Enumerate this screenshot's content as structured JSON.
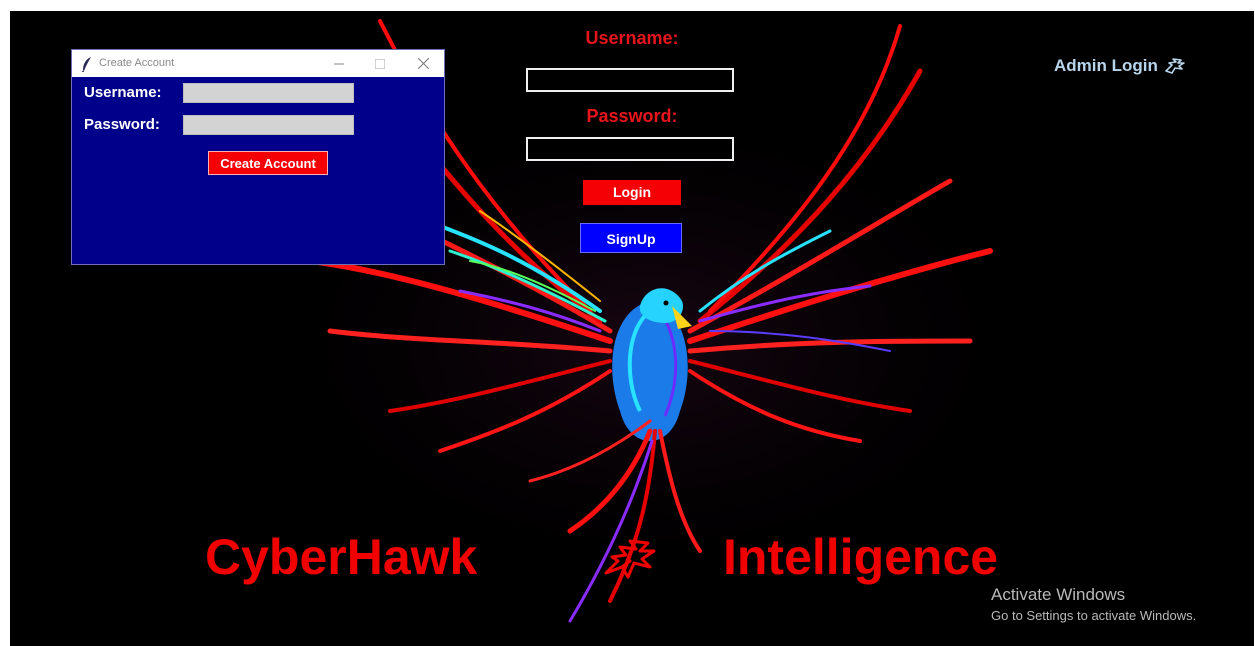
{
  "login_panel": {
    "username_label": "Username:",
    "password_label": "Password:",
    "username_value": "",
    "password_value": "",
    "login_button": "Login",
    "signup_button": "SignUp"
  },
  "admin": {
    "label": "Admin Login",
    "icon": "hawk-icon"
  },
  "brand": {
    "left_word": "CyberHawk",
    "right_word": "Intelligence",
    "logo_icon": "hawk-logo-icon",
    "color": "#f10000"
  },
  "dialog": {
    "title": "Create Account",
    "title_icon": "feather-icon",
    "username_label": "Username:",
    "password_label": "Password:",
    "username_value": "",
    "password_value": "",
    "create_button": "Create Account",
    "background": "#00008b"
  },
  "watermark": {
    "title": "Activate Windows",
    "subtitle": "Go to Settings to activate Windows."
  },
  "colors": {
    "accent_red": "#f40005",
    "signup_blue": "#0000ff",
    "admin_text": "#b8d4ea"
  }
}
